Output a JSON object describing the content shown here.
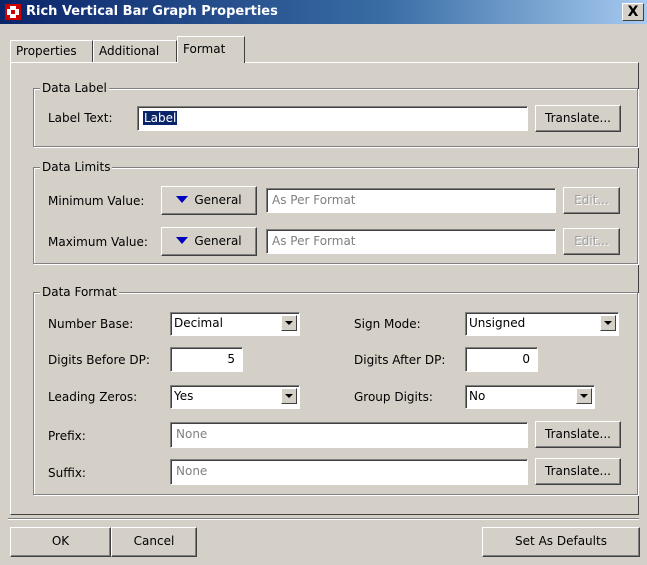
{
  "window": {
    "title": "Rich Vertical Bar Graph Properties",
    "close_label": "X"
  },
  "tabs": [
    {
      "label": "Properties"
    },
    {
      "label": "Additional"
    },
    {
      "label": "Format"
    }
  ],
  "data_label": {
    "legend": "Data Label",
    "label_text_label": "Label Text:",
    "label_text_value": "Label",
    "translate_label": "Translate..."
  },
  "data_limits": {
    "legend": "Data Limits",
    "min_label": "Minimum Value:",
    "min_mode": "General",
    "min_value": "As Per Format",
    "min_edit": "Edit...",
    "max_label": "Maximum Value:",
    "max_mode": "General",
    "max_value": "As Per Format",
    "max_edit": "Edit..."
  },
  "data_format": {
    "legend": "Data Format",
    "number_base_label": "Number Base:",
    "number_base_value": "Decimal",
    "sign_mode_label": "Sign Mode:",
    "sign_mode_value": "Unsigned",
    "digits_before_label": "Digits Before DP:",
    "digits_before_value": "5",
    "digits_after_label": "Digits After DP:",
    "digits_after_value": "0",
    "leading_zeros_label": "Leading Zeros:",
    "leading_zeros_value": "Yes",
    "group_digits_label": "Group Digits:",
    "group_digits_value": "No",
    "prefix_label": "Prefix:",
    "prefix_value": "None",
    "prefix_translate": "Translate...",
    "suffix_label": "Suffix:",
    "suffix_value": "None",
    "suffix_translate": "Translate..."
  },
  "footer": {
    "ok_label": "OK",
    "cancel_label": "Cancel",
    "defaults_label": "Set As Defaults"
  }
}
